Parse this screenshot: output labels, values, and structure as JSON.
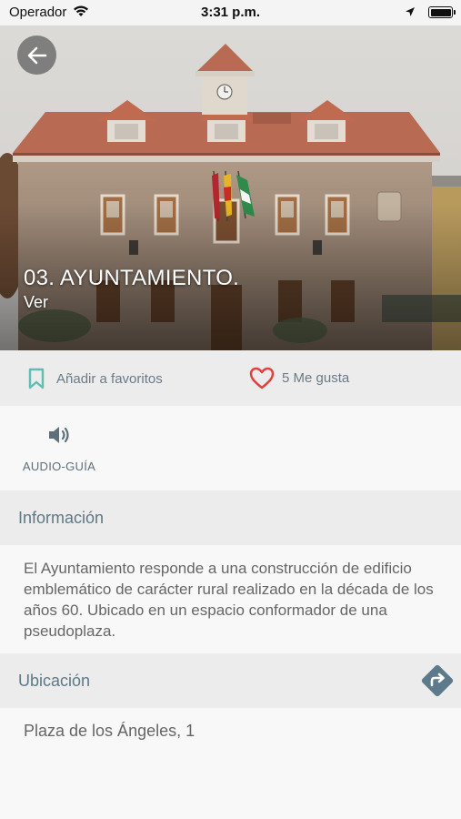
{
  "status_bar": {
    "carrier": "Operador",
    "time": "3:31 p.m."
  },
  "hero": {
    "title": "03. AYUNTAMIENTO.",
    "subtitle": "Ver"
  },
  "actions": {
    "favorites_label": "Añadir a favoritos",
    "likes_label": "5 Me gusta"
  },
  "audio": {
    "label": "AUDIO-GUÍA"
  },
  "info": {
    "title": "Información",
    "text": "El Ayuntamiento responde a una construcción de edificio emblemático de carácter rural realizado en la década de los años 60. Ubicado en un espacio conformador de una pseudoplaza."
  },
  "location": {
    "title": "Ubicación",
    "address": "Plaza de los Ángeles, 1"
  },
  "colors": {
    "accent_teal": "#5bbfb5",
    "heart_red": "#e0433e",
    "text_slate": "#5f7885",
    "directions_blue": "#5d7a8c"
  }
}
